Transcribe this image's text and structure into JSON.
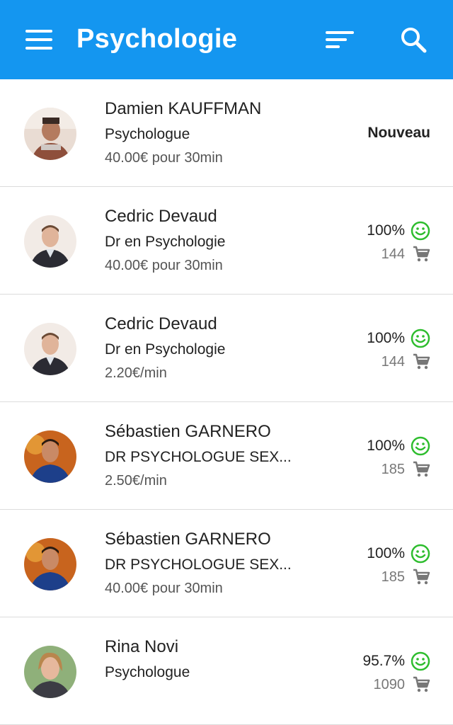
{
  "header": {
    "title": "Psychologie",
    "icons": [
      "menu-icon",
      "sort-icon",
      "search-icon"
    ],
    "color": "#1496f0"
  },
  "colors": {
    "smiley": "#2ebd2e",
    "cart": "#777777"
  },
  "experts": [
    {
      "name": "Damien KAUFFMAN",
      "specialty": "Psychologue",
      "price": "40.00€ pour 30min",
      "badge": "Nouveau"
    },
    {
      "name": "Cedric Devaud",
      "specialty": "Dr en Psychologie",
      "price": "40.00€ pour 30min",
      "rating": "100%",
      "sales": "144"
    },
    {
      "name": "Cedric Devaud",
      "specialty": "Dr en Psychologie",
      "price": "2.20€/min",
      "rating": "100%",
      "sales": "144"
    },
    {
      "name": "Sébastien GARNERO",
      "specialty": "DR PSYCHOLOGUE SEX...",
      "price": "2.50€/min",
      "rating": "100%",
      "sales": "185"
    },
    {
      "name": "Sébastien GARNERO",
      "specialty": "DR PSYCHOLOGUE SEX...",
      "price": "40.00€ pour 30min",
      "rating": "100%",
      "sales": "185"
    },
    {
      "name": "Rina Novi",
      "specialty": "Psychologue",
      "price": "",
      "rating": "95.7%",
      "sales": "1090"
    }
  ]
}
